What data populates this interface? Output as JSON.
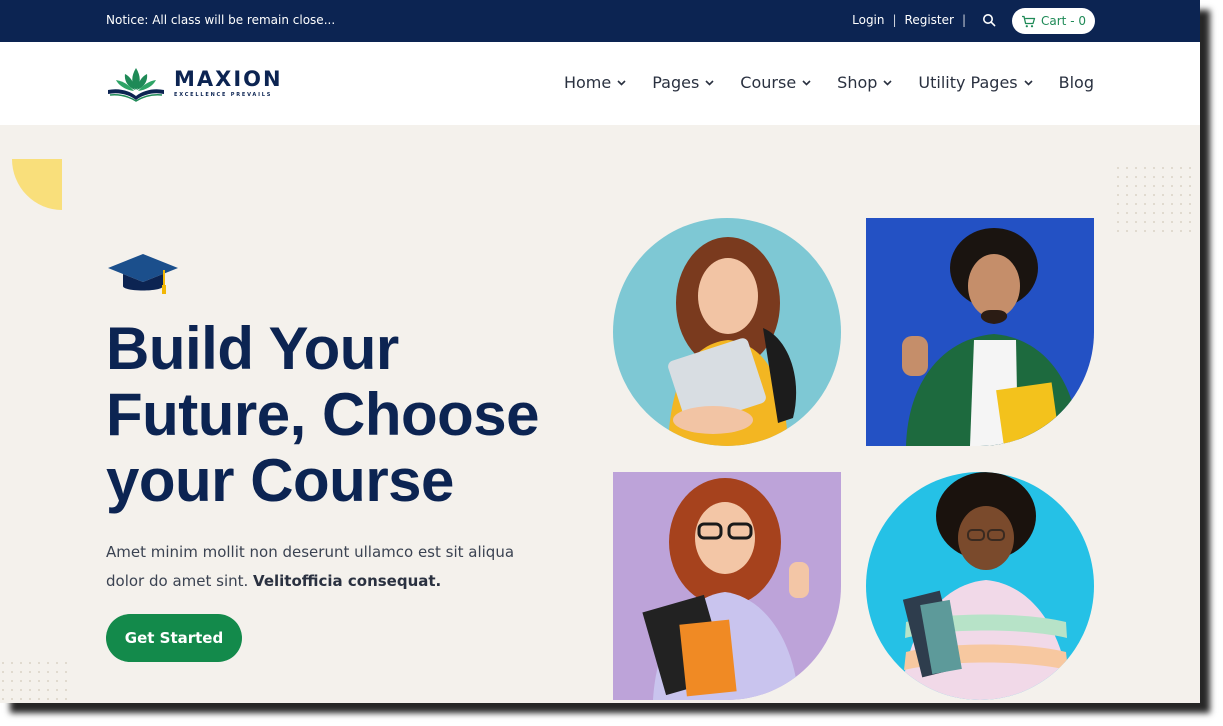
{
  "topbar": {
    "notice": "Notice: All class will be remain close...",
    "login": "Login",
    "register": "Register",
    "separator": "|",
    "cart_label": "Cart - 0"
  },
  "brand": {
    "name": "MAXION",
    "tagline": "EXCELLENCE PREVAILS"
  },
  "nav": {
    "items": [
      {
        "label": "Home"
      },
      {
        "label": "Pages"
      },
      {
        "label": "Course"
      },
      {
        "label": "Shop"
      },
      {
        "label": "Utility Pages"
      },
      {
        "label": "Blog"
      }
    ]
  },
  "hero": {
    "headline_line1": "Build Your",
    "headline_line2": "Future, Choose",
    "headline_line3": "your Course",
    "body": "Amet minim mollit non deserunt ullamco est sit aliqua dolor do amet sint.",
    "body_bold": "Velitofficia consequat.",
    "cta_label": "Get Started"
  },
  "colors": {
    "navy": "#0c2452",
    "green": "#138a4b",
    "hero_bg": "#f4f1ec",
    "accent_yellow": "#f9df7b"
  },
  "icons": {
    "search": "search-icon",
    "cart": "cart-icon",
    "chevron": "chevron-down-icon",
    "graduation": "graduation-cap-icon"
  },
  "photos": [
    {
      "bg": "#7ec8d4"
    },
    {
      "bg": "#2351c4"
    },
    {
      "bg": "#bda3d9"
    },
    {
      "bg": "#25c1e6"
    }
  ]
}
